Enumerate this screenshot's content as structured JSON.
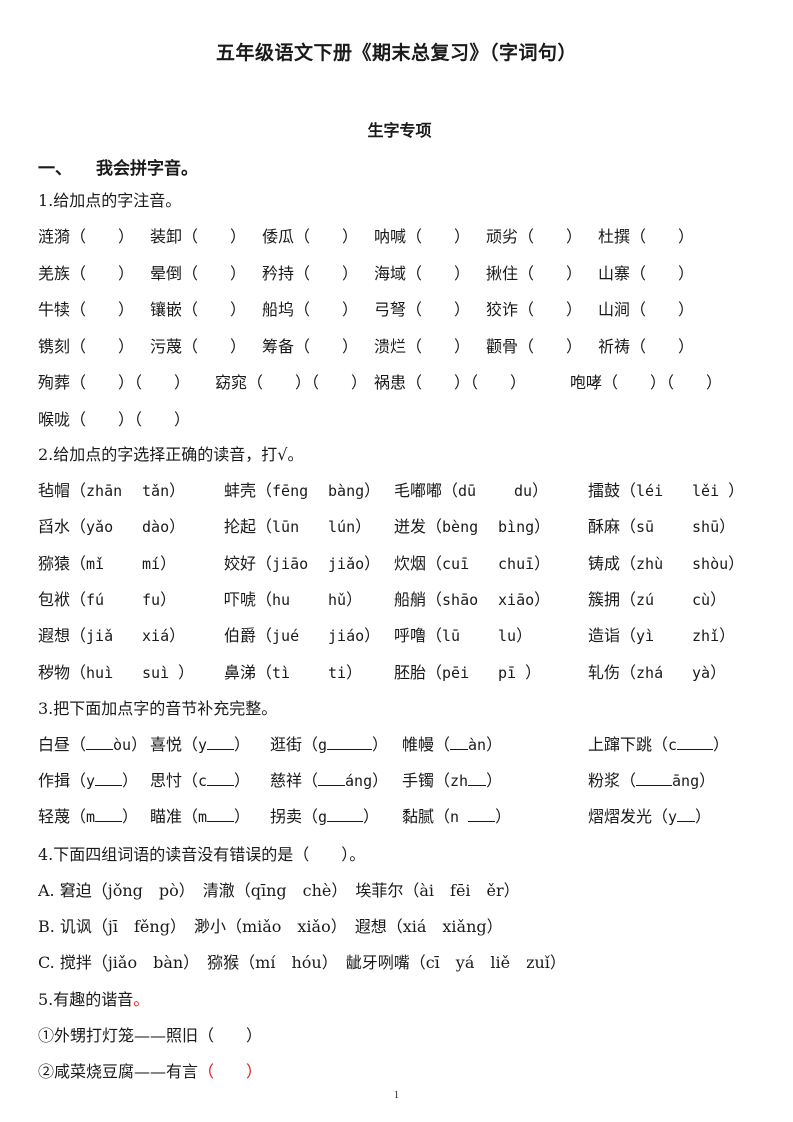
{
  "title": "五年级语文下册《期末总复习》（字词句）",
  "section_title": "生字专项",
  "part1": {
    "number": "一、",
    "label": "我会拼字音。"
  },
  "q1": {
    "title": "1.给加点的字注音。",
    "rows": [
      [
        "涟漪（　　）",
        "装卸（　　）",
        "倭瓜（　　）",
        "呐喊（　　）",
        "顽劣（　　）",
        "杜撰（　　）"
      ],
      [
        "羌族（　　）",
        "晕倒（　　）",
        "矜持（　　）",
        "海域（　　）",
        "揪住（　　）",
        "山寨（　　）"
      ],
      [
        "牛犊（　　）",
        "镶嵌（　　）",
        "船坞（　　）",
        "弓弩（　　）",
        "狡诈（　　）",
        "山涧（　　）"
      ],
      [
        "镌刻（　　）",
        "污蔑（　　）",
        "筹备（　　）",
        "溃烂（　　）",
        "颧骨（　　）",
        "祈祷（　　）"
      ],
      [
        "殉葬（　　）（　　）",
        "窈窕（　　）（　　）",
        "祸患（　　）（　　）",
        "咆哮（　　）（　　）"
      ],
      [
        "喉咙（　　）（　　）"
      ]
    ]
  },
  "q2": {
    "title": "2.给加点的字选择正确的读音，打√。",
    "rows": [
      [
        {
          "w": "毡帽",
          "p1": "zhān",
          "p2": "tǎn"
        },
        {
          "w": "蚌壳",
          "p1": "fēng",
          "p2": "bàng"
        },
        {
          "w": "毛嘟嘟",
          "p1": "dū",
          "p2": "du"
        },
        {
          "w": "擂鼓",
          "p1": "léi",
          "p2": "lěi "
        }
      ],
      [
        {
          "w": "舀水",
          "p1": "yǎo",
          "p2": "dào"
        },
        {
          "w": "抡起",
          "p1": "lūn",
          "p2": "lún"
        },
        {
          "w": "迸发",
          "p1": "bèng",
          "p2": "bìng"
        },
        {
          "w": "酥麻",
          "p1": "sū",
          "p2": "shū"
        }
      ],
      [
        {
          "w": "猕猿",
          "p1": "mǐ",
          "p2": "mí"
        },
        {
          "w": "姣好",
          "p1": "jiāo",
          "p2": "jiǎo"
        },
        {
          "w": "炊烟",
          "p1": "cuī",
          "p2": "chuī"
        },
        {
          "w": "铸成",
          "p1": "zhù",
          "p2": "shòu"
        }
      ],
      [
        {
          "w": "包袱",
          "p1": "fú",
          "p2": "fu"
        },
        {
          "w": "吓唬",
          "p1": "hu",
          "p2": "hǔ"
        },
        {
          "w": "船艄",
          "p1": "shāo",
          "p2": "xiāo"
        },
        {
          "w": "簇拥",
          "p1": "zú",
          "p2": "cù"
        }
      ],
      [
        {
          "w": "遐想",
          "p1": "jiǎ",
          "p2": "xiá"
        },
        {
          "w": "伯爵",
          "p1": "jué",
          "p2": "jiáo"
        },
        {
          "w": "呼噜",
          "p1": "lū",
          "p2": "lu"
        },
        {
          "w": "造诣",
          "p1": "yì",
          "p2": "zhǐ"
        }
      ],
      [
        {
          "w": "秽物",
          "p1": "huì",
          "p2": "suì "
        },
        {
          "w": "鼻涕",
          "p1": "tì",
          "p2": "ti"
        },
        {
          "w": "胚胎",
          "p1": "pēi",
          "p2": "pī "
        },
        {
          "w": "轧伤",
          "p1": "zhá",
          "p2": "yà"
        }
      ]
    ]
  },
  "q3": {
    "title": "3.把下面加点字的音节补充完整。",
    "rows": [
      [
        {
          "w": "白昼",
          "pre": "",
          "post": "òu",
          "n": 3
        },
        {
          "w": "喜悦",
          "pre": "y",
          "post": "",
          "n": 3
        },
        {
          "w": "逛街",
          "pre": "g",
          "post": "",
          "n": 5
        },
        {
          "w": "帷幔",
          "pre": "",
          "post": "àn",
          "n": 2
        },
        {
          "w": "上蹿下跳",
          "pre": "c",
          "post": "",
          "n": 4
        }
      ],
      [
        {
          "w": "作揖",
          "pre": "y",
          "post": "",
          "n": 3
        },
        {
          "w": "忖",
          "pre": "c",
          "post": "",
          "n": 3,
          "full": "思忖"
        },
        {
          "w": "慈祥",
          "pre": "",
          "post": "áng",
          "n": 3
        },
        {
          "w": "手镯",
          "pre": "zh",
          "post": "",
          "n": 2
        },
        {
          "w": "粉浆",
          "pre": "",
          "post": "āng",
          "n": 4
        }
      ],
      [
        {
          "w": "轻蔑",
          "pre": "m",
          "post": "",
          "n": 3
        },
        {
          "w": "瞄准",
          "pre": "m",
          "post": "",
          "n": 3
        },
        {
          "w": "拐卖",
          "pre": "g",
          "post": "",
          "n": 4
        },
        {
          "w": "黏腻",
          "pre": "n ",
          "post": "",
          "n": 3
        },
        {
          "w": "熠熠发光",
          "pre": "y",
          "post": "",
          "n": 2
        }
      ]
    ]
  },
  "q4": {
    "title": "4.下面四组词语的读音没有错误的是（　　）。",
    "options": [
      "A. 窘迫（jǒng　pò）　清澈（qīng　chè）　埃菲尔（ài　fēi　ěr）",
      "B. 讥讽（jī　fěng）　渺小（miǎo　xiǎo）　遐想（xiá　xiǎng）",
      "C. 搅拌（jiǎo　bàn）　猕猴（mí　hóu）　龇牙咧嘴（cī　yá　liě　zuǐ）"
    ]
  },
  "q5": {
    "title": "5.有趣的谐音",
    "title_end": "。",
    "items": [
      {
        "text": "①外甥打灯笼——照旧",
        "blank": "（　　）",
        "blank_color": "#1a1a1a"
      },
      {
        "text": "②咸菜烧豆腐——有言",
        "blank": "（　　）",
        "blank_color": "#e8141e"
      }
    ]
  },
  "page_number": "1"
}
